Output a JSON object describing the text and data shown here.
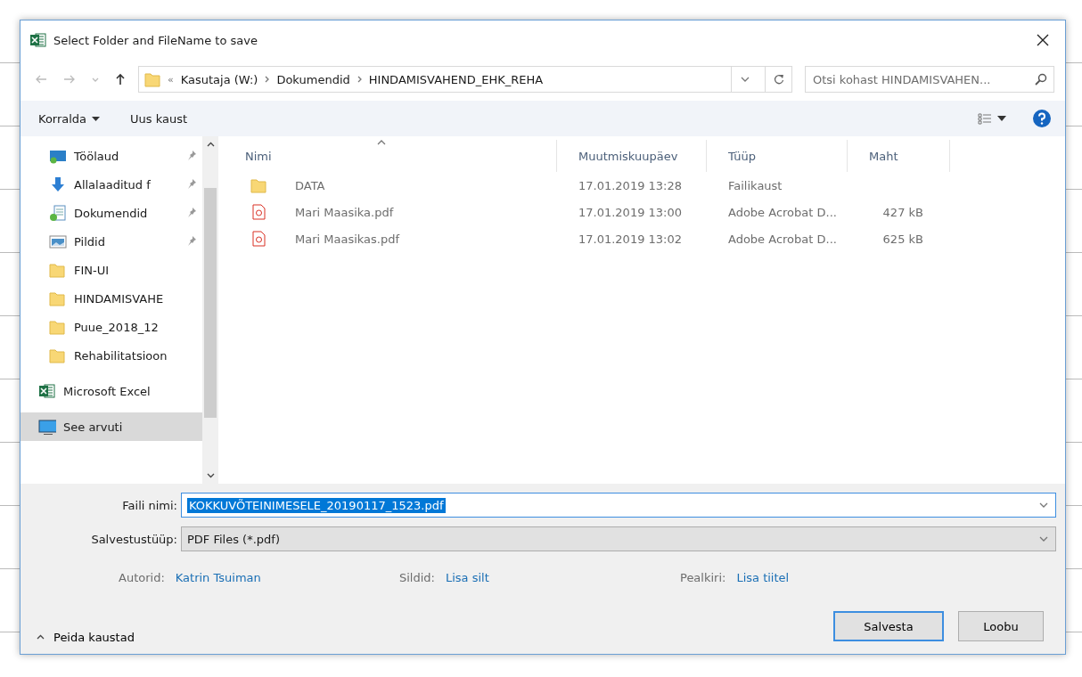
{
  "window": {
    "title": "Select Folder and FileName to save"
  },
  "address": {
    "overflow": "«",
    "crumbs": [
      "Kasutaja (W:)",
      "Dokumendid",
      "HINDAMISVAHEND_EHK_REHA"
    ]
  },
  "search": {
    "placeholder": "Otsi kohast HINDAMISVAHEN..."
  },
  "toolbar": {
    "organize": "Korralda",
    "new_folder": "Uus kaust"
  },
  "sidebar": {
    "items": [
      {
        "label": "Töölaud",
        "kind": "desktop",
        "pinned": true,
        "selected": false
      },
      {
        "label": "Allalaaditud f",
        "kind": "download",
        "pinned": true,
        "selected": false
      },
      {
        "label": "Dokumendid",
        "kind": "documents",
        "pinned": true,
        "selected": false
      },
      {
        "label": "Pildid",
        "kind": "pictures",
        "pinned": true,
        "selected": false
      },
      {
        "label": "FIN-UI",
        "kind": "folder",
        "pinned": false,
        "selected": false
      },
      {
        "label": "HINDAMISVAHE",
        "kind": "folder",
        "pinned": false,
        "selected": false
      },
      {
        "label": "Puue_2018_12",
        "kind": "folder",
        "pinned": false,
        "selected": false
      },
      {
        "label": "Rehabilitatsioon",
        "kind": "folder",
        "pinned": false,
        "selected": false
      },
      {
        "label": "Microsoft Excel",
        "kind": "excel",
        "pinned": false,
        "selected": false
      },
      {
        "label": "See arvuti",
        "kind": "computer",
        "pinned": false,
        "selected": true
      }
    ]
  },
  "table": {
    "columns": [
      "Nimi",
      "Muutmiskuupäev",
      "Tüüp",
      "Maht"
    ],
    "rows": [
      {
        "kind": "folder",
        "cells": [
          "DATA",
          "17.01.2019 13:28",
          "Failikaust",
          ""
        ]
      },
      {
        "kind": "pdf",
        "cells": [
          "Mari Maasika.pdf",
          "17.01.2019 13:00",
          "Adobe Acrobat D...",
          "427 kB"
        ]
      },
      {
        "kind": "pdf",
        "cells": [
          "Mari Maasikas.pdf",
          "17.01.2019 13:02",
          "Adobe Acrobat D...",
          "625 kB"
        ]
      }
    ]
  },
  "form": {
    "filename_label": "Faili nimi:",
    "filename": "KOKKUVÕTEINIMESELE_20190117_1523.pdf",
    "type_label": "Salvestustüüp:",
    "type": "PDF Files (*.pdf)"
  },
  "meta": [
    {
      "label": "Autorid:",
      "value": "Katrin Tsuiman"
    },
    {
      "label": "Sildid:",
      "value": "Lisa silt"
    },
    {
      "label": "Pealkiri:",
      "value": "Lisa tiitel"
    }
  ],
  "footer": {
    "toggle": "Peida kaustad",
    "buttons": [
      {
        "label": "Salvesta",
        "default": true
      },
      {
        "label": "Loobu",
        "default": false
      }
    ]
  }
}
